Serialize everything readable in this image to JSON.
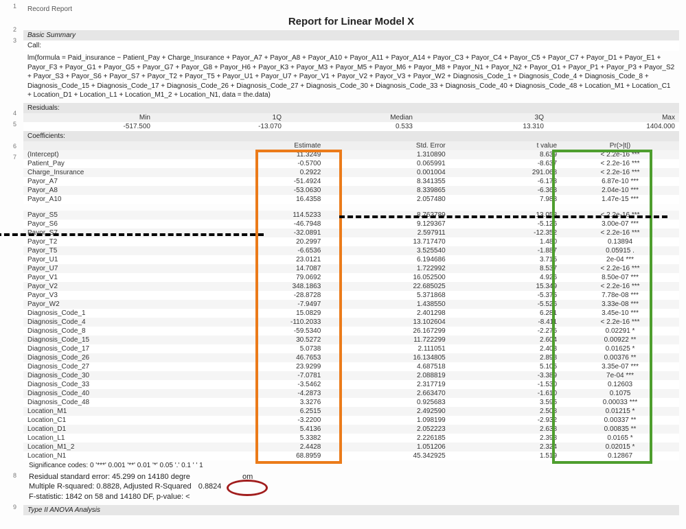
{
  "record_label": "Record Report",
  "title": "Report for Linear Model X",
  "basic_summary_hdr": "Basic Summary",
  "call_hdr": "Call:",
  "formula_text": "lm(formula = Paid_insurance ~ Patient_Pay + Charge_Insurance + Payor_A7 + Payor_A8 + Payor_A10 + Payor_A11 + Payor_A14 + Payor_C3 + Payor_C4 + Payor_C5 + Payor_C7 + Payor_D1 + Payor_E1 + Payor_F3 + Payor_G1 + Payor_G5 + Payor_G7 + Payor_G8 + Payor_H6 + Payor_K3 + Payor_M3 + Payor_M5 + Payor_M6 + Payor_M8 + Payor_N1 + Payor_N2 + Payor_O1 + Payor_P1 + Payor_P3 + Payor_S2 + Payor_S3 + Payor_S6 + Payor_S7 + Payor_T2 + Payor_T5 + Payor_U1 + Payor_U7 + Payor_V1 + Payor_V2 + Payor_V3 + Payor_W2 + Diagnosis_Code_1 + Diagnosis_Code_4 +    Diagnosis_Code_8 + Diagnosis_Code_15 + Diagnosis_Code_17 + Diagnosis_Code_26 + Diagnosis_Code_27 + Diagnosis_Code_30 + Diagnosis_Code_33 + Diagnosis_Code_40 + Diagnosis_Code_48 + Location_M1 + Location_C1 + Location_D1 + Location_L1 + Location_M1_2 + Location_N1, data = the.data)",
  "residuals_hdr": "Residuals:",
  "residuals": {
    "headers": [
      "Min",
      "1Q",
      "Median",
      "3Q",
      "Max"
    ],
    "vals": [
      "-517.500",
      "-13.070",
      "0.533",
      "13.310",
      "1404.000"
    ]
  },
  "coefficients_hdr": "Coefficients:",
  "coef_headers": [
    "",
    "Estimate",
    "Std. Error",
    "t value",
    "Pr(>|t|)"
  ],
  "coef_rows_top": [
    [
      "(Intercept)",
      "11.3249",
      "1.310890",
      "8.639",
      "< 2.2e-16 ***"
    ],
    [
      "Patient_Pay",
      "-0.5700",
      "0.065991",
      "-8.637",
      "< 2.2e-16 ***"
    ],
    [
      "Charge_Insurance",
      "0.2922",
      "0.001004",
      "291.068",
      "< 2.2e-16 ***"
    ],
    [
      "Payor_A7",
      "-51.4924",
      "8.341355",
      "-6.173",
      "6.87e-10 ***"
    ],
    [
      "Payor_A8",
      "-53.0630",
      "8.339865",
      "-6.363",
      "2.04e-10 ***"
    ],
    [
      "Payor_A10",
      "16.4358",
      "2.057480",
      "7.988",
      "1.47e-15 ***"
    ]
  ],
  "coef_rows_bottom": [
    [
      "Payor_S5",
      "114.5233",
      "8.763789",
      "13.058",
      "< 2.2e-16 ***"
    ],
    [
      "Payor_S6",
      "-46.7948",
      "9.129367",
      "-5.126",
      "3.00e-07 ***"
    ],
    [
      "Payor_S7",
      "-32.0891",
      "2.597911",
      "-12.352",
      "< 2.2e-16 ***"
    ],
    [
      "Payor_T2",
      "20.2997",
      "13.717470",
      "1.480",
      "0.13894"
    ],
    [
      "Payor_T5",
      "-6.6536",
      "3.525540",
      "-1.887",
      "0.05915 ."
    ],
    [
      "Payor_U1",
      "23.0121",
      "6.194686",
      "3.715",
      "2e-04 ***"
    ],
    [
      "Payor_U7",
      "14.7087",
      "1.722992",
      "8.537",
      "< 2.2e-16 ***"
    ],
    [
      "Payor_V1",
      "79.0692",
      "16.052500",
      "4.926",
      "8.50e-07 ***"
    ],
    [
      "Payor_V2",
      "348.1863",
      "22.685025",
      "15.349",
      "< 2.2e-16 ***"
    ],
    [
      "Payor_V3",
      "-28.8728",
      "5.371868",
      "-5.375",
      "7.78e-08 ***"
    ],
    [
      "Payor_W2",
      "-7.9497",
      "1.438550",
      "-5.526",
      "3.33e-08 ***"
    ],
    [
      "Diagnosis_Code_1",
      "15.0829",
      "2.401298",
      "6.281",
      "3.45e-10 ***"
    ],
    [
      "Diagnosis_Code_4",
      "-110.2033",
      "13.102604",
      "-8.411",
      "< 2.2e-16 ***"
    ],
    [
      "Diagnosis_Code_8",
      "-59.5340",
      "26.167299",
      "-2.275",
      "0.02291 *"
    ],
    [
      "Diagnosis_Code_15",
      "30.5272",
      "11.722299",
      "2.604",
      "0.00922 **"
    ],
    [
      "Diagnosis_Code_17",
      "5.0738",
      "2.111051",
      "2.403",
      "0.01625 *"
    ],
    [
      "Diagnosis_Code_26",
      "46.7653",
      "16.134805",
      "2.898",
      "0.00376 **"
    ],
    [
      "Diagnosis_Code_27",
      "23.9299",
      "4.687518",
      "5.105",
      "3.35e-07 ***"
    ],
    [
      "Diagnosis_Code_30",
      "-7.0781",
      "2.088819",
      "-3.389",
      "7e-04 ***"
    ],
    [
      "Diagnosis_Code_33",
      "-3.5462",
      "2.317719",
      "-1.530",
      "0.12603"
    ],
    [
      "Diagnosis_Code_40",
      "-4.2873",
      "2.663470",
      "-1.610",
      "0.1075"
    ],
    [
      "Diagnosis_Code_48",
      "3.3276",
      "0.925683",
      "3.595",
      "0.00033 ***"
    ],
    [
      "Location_M1",
      "6.2515",
      "2.492590",
      "2.508",
      "0.01215 *"
    ],
    [
      "Location_C1",
      "-3.2200",
      "1.098199",
      "-2.932",
      "0.00337 **"
    ],
    [
      "Location_D1",
      "5.4136",
      "2.052223",
      "2.638",
      "0.00835 **"
    ],
    [
      "Location_L1",
      "5.3382",
      "2.226185",
      "2.398",
      "0.0165 *"
    ],
    [
      "Location_M1_2",
      "2.4428",
      "1.051206",
      "2.324",
      "0.02015 *"
    ],
    [
      "Location_N1",
      "68.8959",
      "45.342925",
      "1.519",
      "0.12867"
    ]
  ],
  "sig_legend": "Significance codes: 0 '***' 0.001 '**' 0.01 '*' 0.05 '.' 0.1 ' ' 1",
  "footer": {
    "line1a": "Residual standard error: 45.299 on 14180 degre",
    "line1b": "om",
    "line2a": "Multiple R-squared: 0.8828, Adjusted R-Squared",
    "line2b": "0.8824",
    "line3a": "F-statistic: 1842 on 58 and 14180 DF, p-value: <"
  },
  "anova_hdr": "Type II ANOVA Analysis"
}
